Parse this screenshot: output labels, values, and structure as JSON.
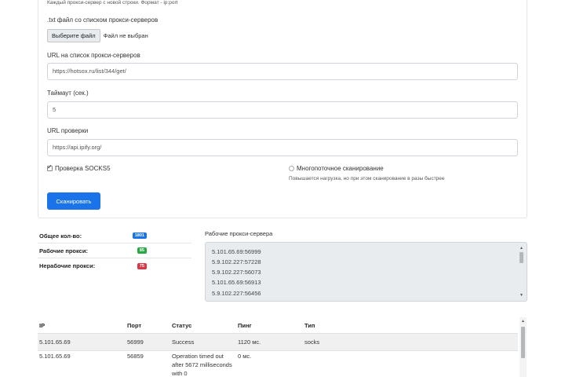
{
  "form": {
    "top_hint": "Каждый прокси-сервер с новой строки. Формат - ip:port",
    "file_label": ".txt файл со списком прокси-серверов",
    "file_button": "Выберите файл",
    "file_status": "Файл не выбран",
    "url_list_label": "URL на список прокси-серверов",
    "url_list_value": "https://hotsox.ru/list/344/get/",
    "timeout_label": "Таймаут (сек.)",
    "timeout_value": "5",
    "check_url_label": "URL проверки",
    "check_url_value": "https://api.ipify.org/",
    "socks_label": "Проверка SOCKS5",
    "socks_checked": true,
    "multithread_label": "Многопоточное сканирование",
    "multithread_checked": false,
    "multithread_hint": "Повышается нагрузка, но при этом сканирование в разы быстрее",
    "scan_button": "Сканировать"
  },
  "stats": [
    {
      "label": "Общее кол-во:",
      "value": "1801",
      "color": "#1a73e8"
    },
    {
      "label": "Рабочие прокси:",
      "value": "85",
      "color": "#28a745"
    },
    {
      "label": "Нерабочие прокси:",
      "value": "75",
      "color": "#dc3545"
    }
  ],
  "working": {
    "title": "Рабочие прокси-сервера",
    "lines": [
      "5.101.65.69:56999",
      "5.9.102.227:57228",
      "5.9.102.227:56073",
      "5.101.65.69:56913",
      "5.9.102.227:56456"
    ]
  },
  "table": {
    "headers": [
      "IP",
      "Порт",
      "Статус",
      "Пинг",
      "Тип"
    ],
    "rows": [
      {
        "ip": "5.101.65.69",
        "port": "56999",
        "status": "Success",
        "ping": "1120 мс.",
        "type": "socks"
      },
      {
        "ip": "5.101.65.69",
        "port": "56859",
        "status": "Operation timed out after 5672 milliseconds with 0",
        "ping": "0 мс.",
        "type": ""
      }
    ]
  }
}
